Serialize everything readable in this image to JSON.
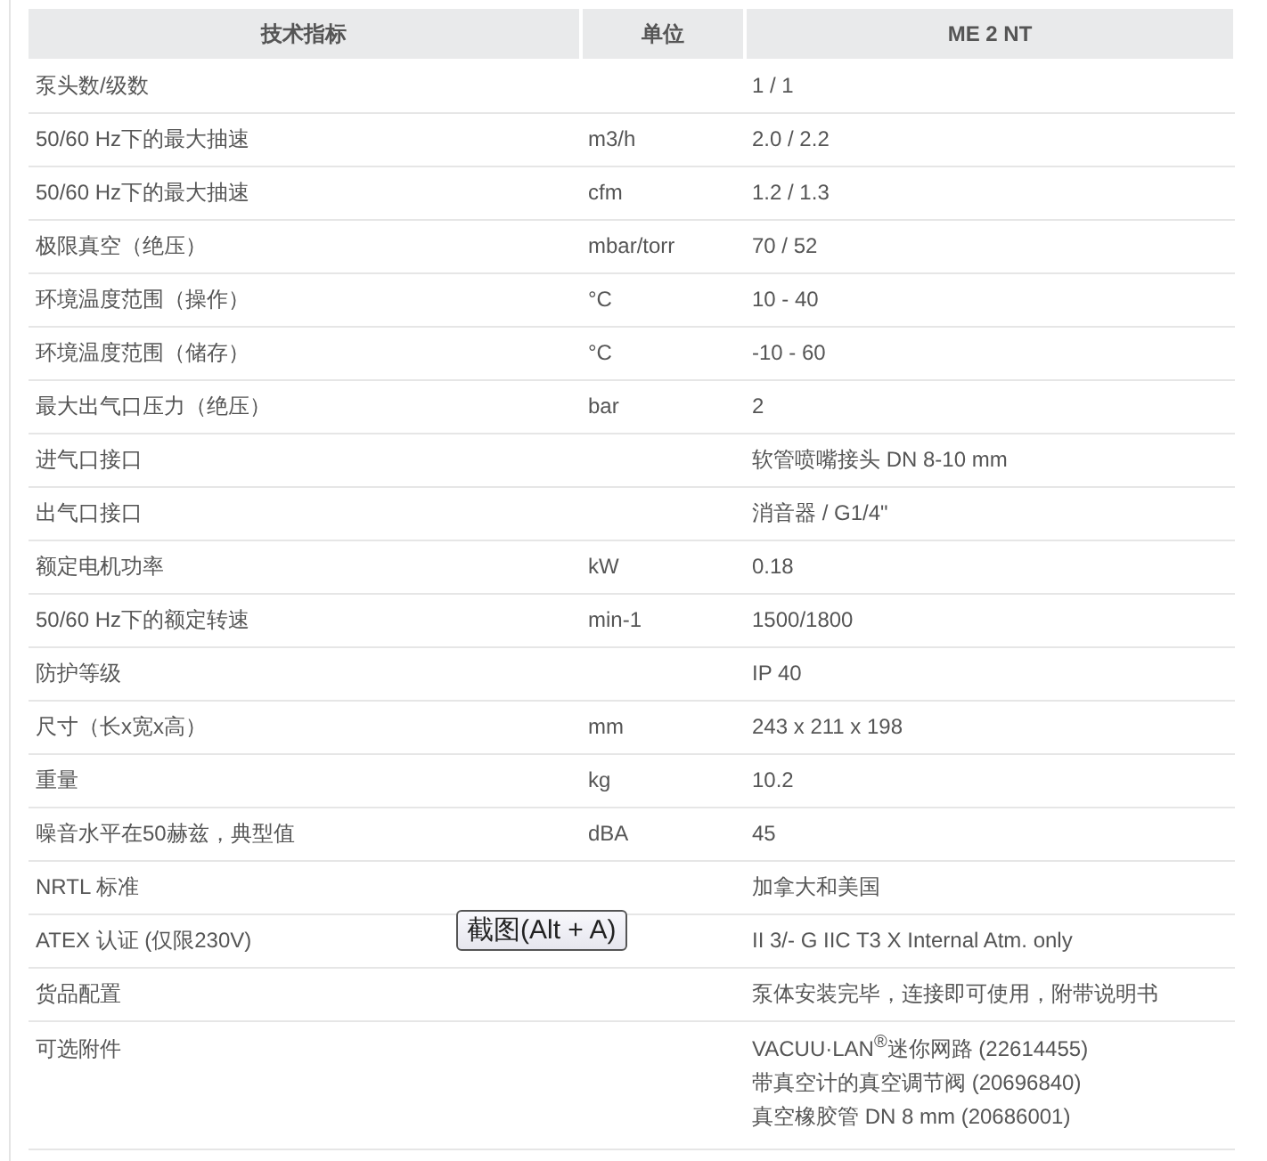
{
  "table": {
    "columns": [
      "技术指标",
      "单位",
      "ME 2 NT"
    ],
    "rows": [
      {
        "spec": "泵头数/级数",
        "unit": "",
        "value": "1 / 1"
      },
      {
        "spec": "50/60 Hz下的最大抽速",
        "unit": "m3/h",
        "value": "2.0 / 2.2"
      },
      {
        "spec": "50/60 Hz下的最大抽速",
        "unit": "cfm",
        "value": "1.2 / 1.3"
      },
      {
        "spec": "极限真空（绝压）",
        "unit": "mbar/torr",
        "value": "70 / 52"
      },
      {
        "spec": "环境温度范围（操作）",
        "unit": "°C",
        "value": "10 - 40"
      },
      {
        "spec": "环境温度范围（储存）",
        "unit": "°C",
        "value": "-10 - 60"
      },
      {
        "spec": "最大出气口压力（绝压）",
        "unit": "bar",
        "value": "2"
      },
      {
        "spec": "进气口接口",
        "unit": "",
        "value": "软管喷嘴接头 DN 8-10 mm"
      },
      {
        "spec": "出气口接口",
        "unit": "",
        "value": "消音器 / G1/4\""
      },
      {
        "spec": "额定电机功率",
        "unit": "kW",
        "value": "0.18"
      },
      {
        "spec": "50/60 Hz下的额定转速",
        "unit": "min-1",
        "value": "1500/1800"
      },
      {
        "spec": "防护等级",
        "unit": "",
        "value": "IP 40"
      },
      {
        "spec": "尺寸（长x宽x高）",
        "unit": "mm",
        "value": "243 x 211 x 198"
      },
      {
        "spec": "重量",
        "unit": "kg",
        "value": "10.2"
      },
      {
        "spec": "噪音水平在50赫兹，典型值",
        "unit": "dBA",
        "value": "45"
      },
      {
        "spec": "NRTL 标准",
        "unit": "",
        "value": "加拿大和美国"
      },
      {
        "spec": "ATEX 认证 (仅限230V)",
        "unit": "",
        "value": "II 3/- G IIC T3 X Internal Atm. only"
      },
      {
        "spec": "货品配置",
        "unit": "",
        "value": "泵体安装完毕，连接即可使用，附带说明书"
      },
      {
        "spec": "可选附件",
        "unit": "",
        "value_lines": [
          "VACUU·LAN$^{®}$迷你网路 (22614455)",
          "带真空计的真空调节阀 (20696840)",
          "真空橡胶管 DN 8 mm (20686001)"
        ]
      }
    ]
  },
  "tooltip": {
    "text": "截图(Alt + A)"
  }
}
